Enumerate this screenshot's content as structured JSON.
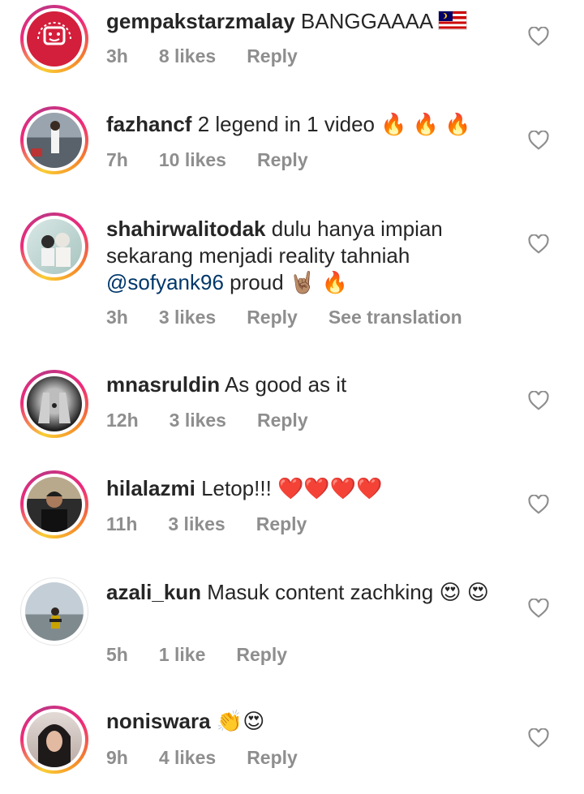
{
  "comments": [
    {
      "username": "gempakstarzmalay",
      "text": "BANGGAAAA",
      "emoji": "",
      "time": "3h",
      "likes": "8 likes",
      "reply": "Reply",
      "extra": ""
    },
    {
      "username": "fazhancf",
      "text": "2 legend in 1 video",
      "emoji": "🔥 🔥 🔥",
      "time": "7h",
      "likes": "10 likes",
      "reply": "Reply",
      "extra": ""
    },
    {
      "username": "shahirwalitodak",
      "text": "dulu hanya impian sekarang menjadi reality tahniah",
      "mention": "@sofyank96",
      "text2": "proud",
      "emoji": "🤘🏽 🔥",
      "time": "3h",
      "likes": "3 likes",
      "reply": "Reply",
      "extra": "See translation"
    },
    {
      "username": "mnasruldin",
      "text": "As good as it",
      "emoji": "",
      "time": "12h",
      "likes": "3 likes",
      "reply": "Reply",
      "extra": ""
    },
    {
      "username": "hilalazmi",
      "text": "Letop!!!",
      "emoji": "❤️❤️❤️❤️",
      "time": "11h",
      "likes": "3 likes",
      "reply": "Reply",
      "extra": ""
    },
    {
      "username": "azali_kun",
      "text": "Masuk content zachking",
      "emoji": "😍 😍",
      "time": "5h",
      "likes": "1 like",
      "reply": "Reply",
      "extra": ""
    },
    {
      "username": "noniswara",
      "text": "",
      "emoji": "👏😍",
      "time": "9h",
      "likes": "4 likes",
      "reply": "Reply",
      "extra": ""
    }
  ],
  "icons": {
    "like": "heart-outline-icon",
    "flag": "malaysia-flag"
  },
  "colors": {
    "username": "#262626",
    "meta": "#8e8e8e",
    "mention": "#00376b",
    "story_ring": "#ee2a7b"
  }
}
